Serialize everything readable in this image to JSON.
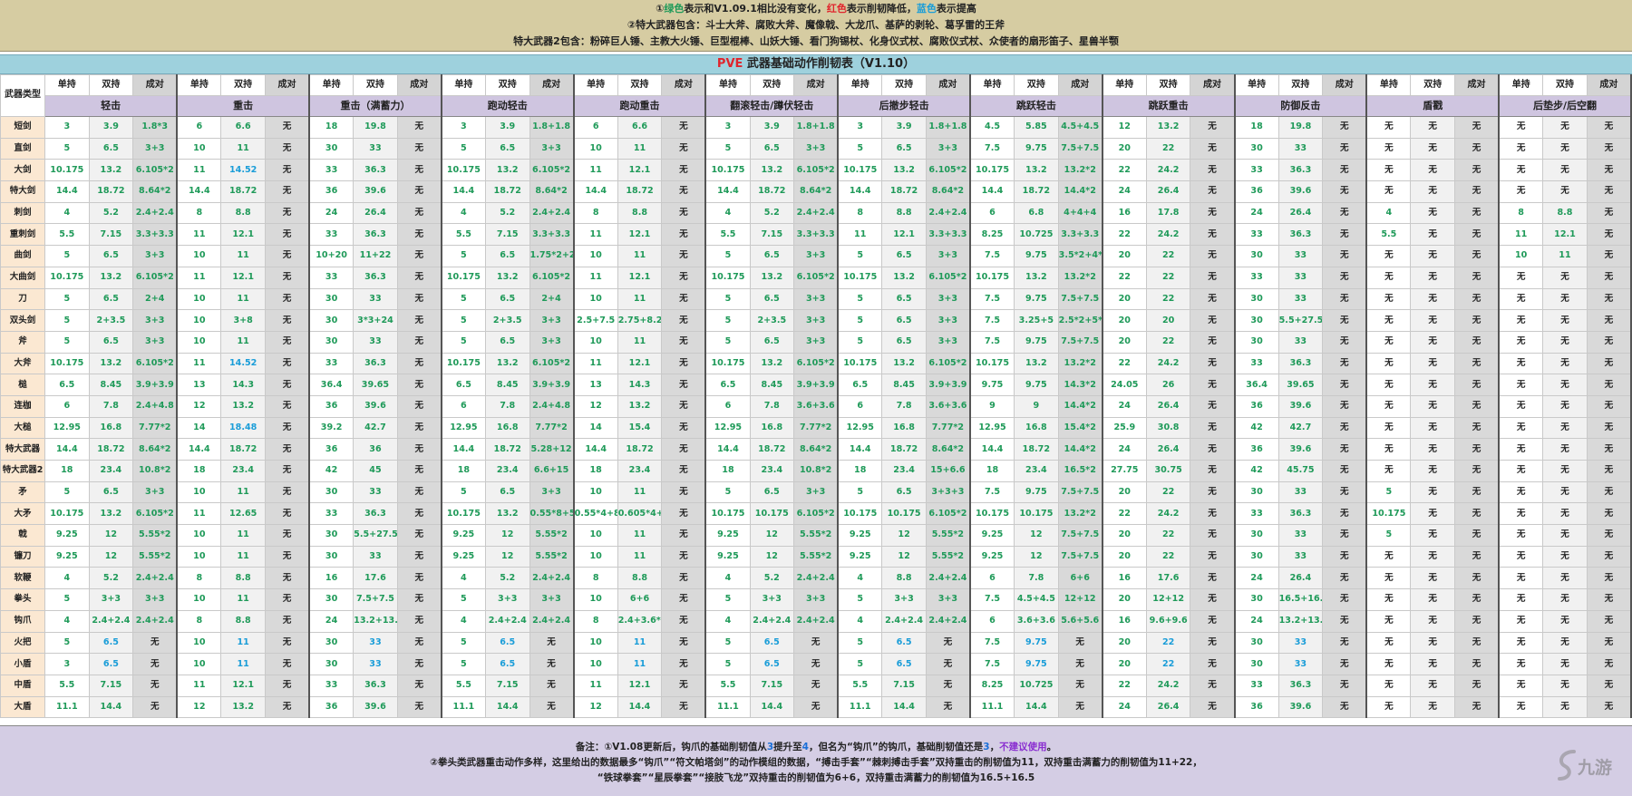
{
  "header": {
    "line1_prefix": "①",
    "line1_green": "绿色",
    "line1_mid": "表示和V1.09.1相比没有变化，",
    "line1_red": "红色",
    "line1_mid2": "表示削韧降低，",
    "line1_blue": "蓝色",
    "line1_end": "表示提高",
    "line2": "②特大武器包含：斗士大斧、腐败大斧、魔像戟、大龙爪、基萨的剥轮、葛孚雷的王斧",
    "line3": "特大武器2包含：粉碎巨人锤、主教大火锤、巨型棍棒、山妖大锤、看门狗锡杖、化身仪式杖、腐败仪式杖、众使者的扇形笛子、星兽半颚"
  },
  "title_pve": "PVE",
  "title_rest": " 武器基础动作削韧表（V1.10）",
  "weapon_type_label": "武器类型",
  "sub_labels": [
    "单持",
    "双持",
    "成对"
  ],
  "groups": [
    "轻击",
    "重击",
    "重击（满蓄力）",
    "跑动轻击",
    "跑动重击",
    "翻滚轻击/蹲伏轻击",
    "后撤步轻击",
    "跳跃轻击",
    "跳跃重击",
    "防御反击",
    "盾戳",
    "后垫步/后空翻"
  ],
  "colors": {
    "green": "#1f9a59",
    "blue": "#1a9dd8",
    "red": "#e0242c",
    "header_bg": "#d6cca2",
    "title_bg": "#9ed1dd",
    "group_bg": "#cfc5e0",
    "name_bg": "#fbe8d2"
  },
  "rows": [
    {
      "name": "短剑",
      "c": [
        "3",
        "3.9",
        "1.8*3",
        "6",
        "6.6",
        "无",
        "18",
        "19.8",
        "无",
        "3",
        "3.9",
        "1.8+1.8",
        "6",
        "6.6",
        "无",
        "3",
        "3.9",
        "1.8+1.8",
        "3",
        "3.9",
        "1.8+1.8",
        "4.5",
        "5.85",
        "4.5+4.5",
        "12",
        "13.2",
        "无",
        "18",
        "19.8",
        "无",
        "无",
        "无",
        "无",
        "无",
        "无",
        "无"
      ]
    },
    {
      "name": "直剑",
      "c": [
        "5",
        "6.5",
        "3+3",
        "10",
        "11",
        "无",
        "30",
        "33",
        "无",
        "5",
        "6.5",
        "3+3",
        "10",
        "11",
        "无",
        "5",
        "6.5",
        "3+3",
        "5",
        "6.5",
        "3+3",
        "7.5",
        "9.75",
        "7.5+7.5",
        "20",
        "22",
        "无",
        "30",
        "33",
        "无",
        "无",
        "无",
        "无",
        "无",
        "无",
        "无"
      ]
    },
    {
      "name": "大剑",
      "c": [
        "10.175",
        "13.2",
        "6.105*2",
        "11",
        "14.52",
        "无",
        "33",
        "36.3",
        "无",
        "10.175",
        "13.2",
        "6.105*2",
        "11",
        "12.1",
        "无",
        "10.175",
        "13.2",
        "6.105*2",
        "10.175",
        "13.2",
        "6.105*2",
        "10.175",
        "13.2",
        "13.2*2",
        "22",
        "24.2",
        "无",
        "33",
        "36.3",
        "无",
        "无",
        "无",
        "无",
        "无",
        "无",
        "无"
      ]
    },
    {
      "name": "特大剑",
      "c": [
        "14.4",
        "18.72",
        "8.64*2",
        "14.4",
        "18.72",
        "无",
        "36",
        "39.6",
        "无",
        "14.4",
        "18.72",
        "8.64*2",
        "14.4",
        "18.72",
        "无",
        "14.4",
        "18.72",
        "8.64*2",
        "14.4",
        "18.72",
        "8.64*2",
        "14.4",
        "18.72",
        "14.4*2",
        "24",
        "26.4",
        "无",
        "36",
        "39.6",
        "无",
        "无",
        "无",
        "无",
        "无",
        "无",
        "无"
      ]
    },
    {
      "name": "刺剑",
      "c": [
        "4",
        "5.2",
        "2.4+2.4",
        "8",
        "8.8",
        "无",
        "24",
        "26.4",
        "无",
        "4",
        "5.2",
        "2.4+2.4",
        "8",
        "8.8",
        "无",
        "4",
        "5.2",
        "2.4+2.4",
        "8",
        "8.8",
        "2.4+2.4",
        "6",
        "6.8",
        "4+4+4",
        "16",
        "17.8",
        "无",
        "24",
        "26.4",
        "无",
        "4",
        "无",
        "无",
        "8",
        "8.8",
        "无"
      ]
    },
    {
      "name": "重刺剑",
      "c": [
        "5.5",
        "7.15",
        "3.3+3.3",
        "11",
        "12.1",
        "无",
        "33",
        "36.3",
        "无",
        "5.5",
        "7.15",
        "3.3+3.3",
        "11",
        "12.1",
        "无",
        "5.5",
        "7.15",
        "3.3+3.3",
        "11",
        "12.1",
        "3.3+3.3",
        "8.25",
        "10.725",
        "3.3+3.3",
        "22",
        "24.2",
        "无",
        "33",
        "36.3",
        "无",
        "5.5",
        "无",
        "无",
        "11",
        "12.1",
        "无"
      ]
    },
    {
      "name": "曲剑",
      "c": [
        "5",
        "6.5",
        "3+3",
        "10",
        "11",
        "无",
        "10+20",
        "11+22",
        "无",
        "5",
        "6.5",
        "1.75*2+2.5*2",
        "10",
        "11",
        "无",
        "5",
        "6.5",
        "3+3",
        "5",
        "6.5",
        "3+3",
        "7.5",
        "9.75",
        "3.5*2+4*2",
        "20",
        "22",
        "无",
        "30",
        "33",
        "无",
        "无",
        "无",
        "无",
        "10",
        "11",
        "无"
      ]
    },
    {
      "name": "大曲剑",
      "c": [
        "10.175",
        "13.2",
        "6.105*2",
        "11",
        "12.1",
        "无",
        "33",
        "36.3",
        "无",
        "10.175",
        "13.2",
        "6.105*2",
        "11",
        "12.1",
        "无",
        "10.175",
        "13.2",
        "6.105*2",
        "10.175",
        "13.2",
        "6.105*2",
        "10.175",
        "13.2",
        "13.2*2",
        "22",
        "22",
        "无",
        "33",
        "33",
        "无",
        "无",
        "无",
        "无",
        "无",
        "无",
        "无"
      ]
    },
    {
      "name": "刀",
      "c": [
        "5",
        "6.5",
        "2+4",
        "10",
        "11",
        "无",
        "30",
        "33",
        "无",
        "5",
        "6.5",
        "2+4",
        "10",
        "11",
        "无",
        "5",
        "6.5",
        "3+3",
        "5",
        "6.5",
        "3+3",
        "7.5",
        "9.75",
        "7.5+7.5",
        "20",
        "22",
        "无",
        "30",
        "33",
        "无",
        "无",
        "无",
        "无",
        "无",
        "无",
        "无"
      ]
    },
    {
      "name": "双头剑",
      "c": [
        "5",
        "2+3.5",
        "3+3",
        "10",
        "3+8",
        "无",
        "30",
        "3*3+24",
        "无",
        "5",
        "2+3.5",
        "3+3",
        "2.5+7.5",
        "2.75+8.25",
        "无",
        "5",
        "2+3.5",
        "3+3",
        "5",
        "6.5",
        "3+3",
        "7.5",
        "3.25+5",
        "2.5*2+5*2",
        "20",
        "20",
        "无",
        "30",
        "5.5+27.5",
        "无",
        "无",
        "无",
        "无",
        "无",
        "无",
        "无"
      ]
    },
    {
      "name": "斧",
      "c": [
        "5",
        "6.5",
        "3+3",
        "10",
        "11",
        "无",
        "30",
        "33",
        "无",
        "5",
        "6.5",
        "3+3",
        "10",
        "11",
        "无",
        "5",
        "6.5",
        "3+3",
        "5",
        "6.5",
        "3+3",
        "7.5",
        "9.75",
        "7.5+7.5",
        "20",
        "22",
        "无",
        "30",
        "33",
        "无",
        "无",
        "无",
        "无",
        "无",
        "无",
        "无"
      ]
    },
    {
      "name": "大斧",
      "c": [
        "10.175",
        "13.2",
        "6.105*2",
        "11",
        "14.52",
        "无",
        "33",
        "36.3",
        "无",
        "10.175",
        "13.2",
        "6.105*2",
        "11",
        "12.1",
        "无",
        "10.175",
        "13.2",
        "6.105*2",
        "10.175",
        "13.2",
        "6.105*2",
        "10.175",
        "13.2",
        "13.2*2",
        "22",
        "24.2",
        "无",
        "33",
        "36.3",
        "无",
        "无",
        "无",
        "无",
        "无",
        "无",
        "无"
      ]
    },
    {
      "name": "槌",
      "c": [
        "6.5",
        "8.45",
        "3.9+3.9",
        "13",
        "14.3",
        "无",
        "36.4",
        "39.65",
        "无",
        "6.5",
        "8.45",
        "3.9+3.9",
        "13",
        "14.3",
        "无",
        "6.5",
        "8.45",
        "3.9+3.9",
        "6.5",
        "8.45",
        "3.9+3.9",
        "9.75",
        "9.75",
        "14.3*2",
        "24.05",
        "26",
        "无",
        "36.4",
        "39.65",
        "无",
        "无",
        "无",
        "无",
        "无",
        "无",
        "无"
      ]
    },
    {
      "name": "连枷",
      "c": [
        "6",
        "7.8",
        "2.4+4.8",
        "12",
        "13.2",
        "无",
        "36",
        "39.6",
        "无",
        "6",
        "7.8",
        "2.4+4.8",
        "12",
        "13.2",
        "无",
        "6",
        "7.8",
        "3.6+3.6",
        "6",
        "7.8",
        "3.6+3.6",
        "9",
        "9",
        "14.4*2",
        "24",
        "26.4",
        "无",
        "36",
        "39.6",
        "无",
        "无",
        "无",
        "无",
        "无",
        "无",
        "无"
      ]
    },
    {
      "name": "大槌",
      "c": [
        "12.95",
        "16.8",
        "7.77*2",
        "14",
        "18.48",
        "无",
        "39.2",
        "42.7",
        "无",
        "12.95",
        "16.8",
        "7.77*2",
        "14",
        "15.4",
        "无",
        "12.95",
        "16.8",
        "7.77*2",
        "12.95",
        "16.8",
        "7.77*2",
        "12.95",
        "16.8",
        "15.4*2",
        "25.9",
        "30.8",
        "无",
        "42",
        "42.7",
        "无",
        "无",
        "无",
        "无",
        "无",
        "无",
        "无"
      ]
    },
    {
      "name": "特大武器",
      "c": [
        "14.4",
        "18.72",
        "8.64*2",
        "14.4",
        "18.72",
        "无",
        "36",
        "36",
        "无",
        "14.4",
        "18.72",
        "5.28+12",
        "14.4",
        "18.72",
        "无",
        "14.4",
        "18.72",
        "8.64*2",
        "14.4",
        "18.72",
        "8.64*2",
        "14.4",
        "18.72",
        "14.4*2",
        "24",
        "26.4",
        "无",
        "36",
        "39.6",
        "无",
        "无",
        "无",
        "无",
        "无",
        "无",
        "无"
      ]
    },
    {
      "name": "特大武器2",
      "c": [
        "18",
        "23.4",
        "10.8*2",
        "18",
        "23.4",
        "无",
        "42",
        "45",
        "无",
        "18",
        "23.4",
        "6.6+15",
        "18",
        "23.4",
        "无",
        "18",
        "23.4",
        "10.8*2",
        "18",
        "23.4",
        "15+6.6",
        "18",
        "23.4",
        "16.5*2",
        "27.75",
        "30.75",
        "无",
        "42",
        "45.75",
        "无",
        "无",
        "无",
        "无",
        "无",
        "无",
        "无"
      ]
    },
    {
      "name": "矛",
      "c": [
        "5",
        "6.5",
        "3+3",
        "10",
        "11",
        "无",
        "30",
        "33",
        "无",
        "5",
        "6.5",
        "3+3",
        "10",
        "11",
        "无",
        "5",
        "6.5",
        "3+3",
        "5",
        "6.5",
        "3+3+3",
        "7.5",
        "9.75",
        "7.5+7.5",
        "20",
        "22",
        "无",
        "30",
        "33",
        "无",
        "5",
        "无",
        "无",
        "无",
        "无",
        "无"
      ]
    },
    {
      "name": "大矛",
      "c": [
        "10.175",
        "13.2",
        "6.105*2",
        "11",
        "12.65",
        "无",
        "33",
        "36.3",
        "无",
        "10.175",
        "13.2",
        "0.55*8+5.5+5.5",
        "0.55*4+8.8",
        "0.605*4+9.68",
        "无",
        "10.175",
        "10.175",
        "6.105*2",
        "10.175",
        "10.175",
        "6.105*2",
        "10.175",
        "10.175",
        "13.2*2",
        "22",
        "24.2",
        "无",
        "33",
        "36.3",
        "无",
        "10.175",
        "无",
        "无",
        "无",
        "无",
        "无"
      ]
    },
    {
      "name": "戟",
      "c": [
        "9.25",
        "12",
        "5.55*2",
        "10",
        "11",
        "无",
        "30",
        "5.5+27.5",
        "无",
        "9.25",
        "12",
        "5.55*2",
        "10",
        "11",
        "无",
        "9.25",
        "12",
        "5.55*2",
        "9.25",
        "12",
        "5.55*2",
        "9.25",
        "12",
        "7.5+7.5",
        "20",
        "22",
        "无",
        "30",
        "33",
        "无",
        "5",
        "无",
        "无",
        "无",
        "无",
        "无"
      ]
    },
    {
      "name": "镰刀",
      "c": [
        "9.25",
        "12",
        "5.55*2",
        "10",
        "11",
        "无",
        "30",
        "33",
        "无",
        "9.25",
        "12",
        "5.55*2",
        "10",
        "11",
        "无",
        "9.25",
        "12",
        "5.55*2",
        "9.25",
        "12",
        "5.55*2",
        "9.25",
        "12",
        "7.5+7.5",
        "20",
        "22",
        "无",
        "30",
        "33",
        "无",
        "无",
        "无",
        "无",
        "无",
        "无",
        "无"
      ]
    },
    {
      "name": "软鞭",
      "c": [
        "4",
        "5.2",
        "2.4+2.4",
        "8",
        "8.8",
        "无",
        "16",
        "17.6",
        "无",
        "4",
        "5.2",
        "2.4+2.4",
        "8",
        "8.8",
        "无",
        "4",
        "5.2",
        "2.4+2.4",
        "4",
        "8.8",
        "2.4+2.4",
        "6",
        "7.8",
        "6+6",
        "16",
        "17.6",
        "无",
        "24",
        "26.4",
        "无",
        "无",
        "无",
        "无",
        "无",
        "无",
        "无"
      ]
    },
    {
      "name": "拳头",
      "c": [
        "5",
        "3+3",
        "3+3",
        "10",
        "11",
        "无",
        "30",
        "7.5+7.5",
        "无",
        "5",
        "3+3",
        "3+3",
        "10",
        "6+6",
        "无",
        "5",
        "3+3",
        "3+3",
        "5",
        "3+3",
        "3+3",
        "7.5",
        "4.5+4.5",
        "12+12",
        "20",
        "12+12",
        "无",
        "30",
        "16.5+16.5",
        "无",
        "无",
        "无",
        "无",
        "无",
        "无",
        "无"
      ]
    },
    {
      "name": "钩爪",
      "c": [
        "4",
        "2.4+2.4",
        "2.4+2.4",
        "8",
        "8.8",
        "无",
        "24",
        "13.2+13.2",
        "无",
        "4",
        "2.4+2.4",
        "2.4+2.4",
        "8",
        "2.4+3.6*2",
        "无",
        "4",
        "2.4+2.4",
        "2.4+2.4",
        "4",
        "2.4+2.4",
        "2.4+2.4",
        "6",
        "3.6+3.6",
        "5.6+5.6",
        "16",
        "9.6+9.6",
        "无",
        "24",
        "13.2+13.2",
        "无",
        "无",
        "无",
        "无",
        "无",
        "无",
        "无"
      ]
    },
    {
      "name": "火把",
      "c": [
        "5",
        "6.5",
        "无",
        "10",
        "11",
        "无",
        "30",
        "33",
        "无",
        "5",
        "6.5",
        "无",
        "10",
        "11",
        "无",
        "5",
        "6.5",
        "无",
        "5",
        "6.5",
        "无",
        "7.5",
        "9.75",
        "无",
        "20",
        "22",
        "无",
        "30",
        "33",
        "无",
        "无",
        "无",
        "无",
        "无",
        "无",
        "无"
      ]
    },
    {
      "name": "小盾",
      "c": [
        "3",
        "6.5",
        "无",
        "10",
        "11",
        "无",
        "30",
        "33",
        "无",
        "5",
        "6.5",
        "无",
        "10",
        "11",
        "无",
        "5",
        "6.5",
        "无",
        "5",
        "6.5",
        "无",
        "7.5",
        "9.75",
        "无",
        "20",
        "22",
        "无",
        "30",
        "33",
        "无",
        "无",
        "无",
        "无",
        "无",
        "无",
        "无"
      ]
    },
    {
      "name": "中盾",
      "c": [
        "5.5",
        "7.15",
        "无",
        "11",
        "12.1",
        "无",
        "33",
        "36.3",
        "无",
        "5.5",
        "7.15",
        "无",
        "11",
        "12.1",
        "无",
        "5.5",
        "7.15",
        "无",
        "5.5",
        "7.15",
        "无",
        "8.25",
        "10.725",
        "无",
        "22",
        "24.2",
        "无",
        "33",
        "36.3",
        "无",
        "无",
        "无",
        "无",
        "无",
        "无",
        "无"
      ]
    },
    {
      "name": "大盾",
      "c": [
        "11.1",
        "14.4",
        "无",
        "12",
        "13.2",
        "无",
        "36",
        "39.6",
        "无",
        "11.1",
        "14.4",
        "无",
        "12",
        "14.4",
        "无",
        "11.1",
        "14.4",
        "无",
        "11.1",
        "14.4",
        "无",
        "11.1",
        "14.4",
        "无",
        "24",
        "26.4",
        "无",
        "36",
        "39.6",
        "无",
        "无",
        "无",
        "无",
        "无",
        "无",
        "无"
      ]
    }
  ],
  "blue_cells": [
    [
      2,
      4
    ],
    [
      11,
      4
    ],
    [
      14,
      4
    ],
    [
      24,
      1
    ],
    [
      24,
      4
    ],
    [
      24,
      7
    ],
    [
      24,
      10
    ],
    [
      24,
      13
    ],
    [
      24,
      16
    ],
    [
      24,
      19
    ],
    [
      24,
      22
    ],
    [
      24,
      25
    ],
    [
      24,
      28
    ],
    [
      25,
      1
    ],
    [
      25,
      4
    ],
    [
      25,
      7
    ],
    [
      25,
      10
    ],
    [
      25,
      13
    ],
    [
      25,
      16
    ],
    [
      25,
      19
    ],
    [
      25,
      22
    ],
    [
      25,
      25
    ],
    [
      25,
      28
    ]
  ],
  "footer": {
    "line1_a": "备注：①V1.08更新后，钩爪的基础削韧值从",
    "line1_b": "3",
    "line1_c": "提升至",
    "line1_d": "4",
    "line1_e": "，但名为“钩爪”的钩爪，基础削韧值还是",
    "line1_f": "3",
    "line1_g": "，",
    "line1_h": "不建议使用",
    "line1_i": "。",
    "line2": "②拳头类武器重击动作多样，这里给出的数据最多“钩爪”“符文帕塔剑”的动作模组的数据，“搏击手套”“棘刺搏击手套”双持重击的削韧值为11，双持重击满蓄力的削韧值为11+22，",
    "line3": "“铁球拳套”“星辰拳套”“接肢飞龙”双持重击的削韧值为6+6，双持重击满蓄力的削韧值为16.5+16.5"
  },
  "watermark": "九游"
}
